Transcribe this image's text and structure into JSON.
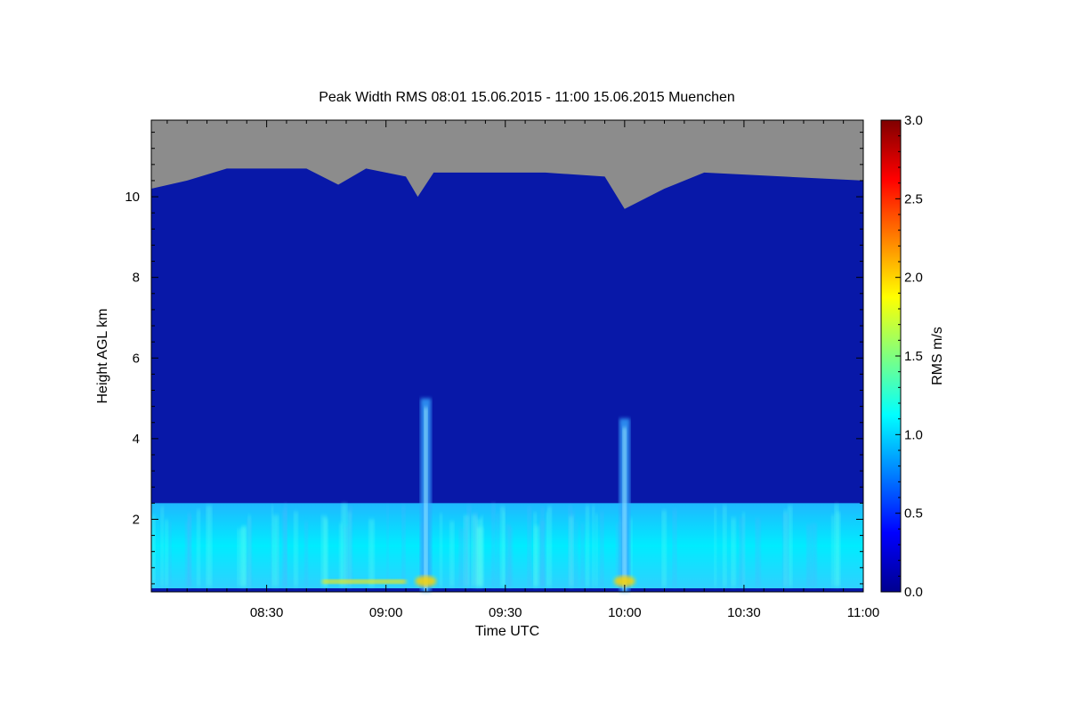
{
  "chart_data": {
    "type": "heatmap",
    "title": "Peak Width RMS   08:01 15.06.2015 - 11:00 15.06.2015 Muenchen",
    "xlabel": "Time UTC",
    "ylabel": "Height AGL km",
    "colorbar_label": "RMS m/s",
    "x_range_utc": [
      "08:01",
      "11:00"
    ],
    "x_ticks": [
      "08:30",
      "09:00",
      "09:30",
      "10:00",
      "10:30",
      "11:00"
    ],
    "y_ticks": [
      2,
      4,
      6,
      8,
      10
    ],
    "ylim_km": [
      0.2,
      11.9
    ],
    "colorbar_range": [
      0.0,
      3.0
    ],
    "colorbar_ticks": [
      "0.0",
      "0.5",
      "1.0",
      "1.5",
      "2.0",
      "2.5",
      "3.0"
    ],
    "no_data_color": "#8c8c8c",
    "colormap": [
      "#00008f",
      "#0000ff",
      "#00ffff",
      "#ffff00",
      "#ff0000",
      "#800000"
    ],
    "boundary_layer_top_km": 2.4,
    "data_top_km": [
      {
        "time": "08:01",
        "height": 10.2
      },
      {
        "time": "08:10",
        "height": 10.4
      },
      {
        "time": "08:20",
        "height": 10.7
      },
      {
        "time": "08:40",
        "height": 10.7
      },
      {
        "time": "08:48",
        "height": 10.3
      },
      {
        "time": "08:55",
        "height": 10.7
      },
      {
        "time": "09:05",
        "height": 10.5
      },
      {
        "time": "09:08",
        "height": 10.0
      },
      {
        "time": "09:12",
        "height": 10.6
      },
      {
        "time": "09:40",
        "height": 10.6
      },
      {
        "time": "09:55",
        "height": 10.5
      },
      {
        "time": "10:00",
        "height": 9.7
      },
      {
        "time": "10:10",
        "height": 10.2
      },
      {
        "time": "10:20",
        "height": 10.6
      },
      {
        "time": "10:40",
        "height": 10.5
      },
      {
        "time": "11:00",
        "height": 10.4
      }
    ],
    "features": [
      {
        "time": "09:10",
        "bottom_km": 0.2,
        "top_km": 5.0,
        "value": 1.2
      },
      {
        "time": "10:00",
        "bottom_km": 0.2,
        "top_km": 4.5,
        "value": 1.1
      }
    ]
  }
}
